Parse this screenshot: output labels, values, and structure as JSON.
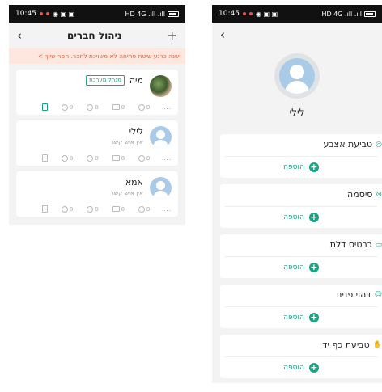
{
  "status": {
    "time": "10:45",
    "indicators": "HD 4G .ıll .ıll"
  },
  "left": {
    "title": "ניהול חברים",
    "back_icon": "chevron-left-icon",
    "add_icon": "plus-icon",
    "banner": "ישנה כרגע שיטת פתיחה לא משויכת לחבר. הסר שיוך >",
    "members": [
      {
        "name": "מיה",
        "badge": "מנהל מערכת",
        "subtitle": "",
        "counts": [
          "0",
          "0",
          "0",
          "0"
        ],
        "more": "..."
      },
      {
        "name": "לילי",
        "badge": "",
        "subtitle": "אין איש קשר",
        "counts": [
          "0",
          "0",
          "0",
          "0"
        ],
        "more": "..."
      },
      {
        "name": "אמא",
        "badge": "",
        "subtitle": "אין איש קשר",
        "counts": [
          "0",
          "0",
          "0",
          "0"
        ],
        "more": "..."
      }
    ]
  },
  "right": {
    "back_icon": "chevron-left-icon",
    "name": "לילי",
    "sections": [
      {
        "title": "טביעת אצבע",
        "icon": "fingerprint-icon",
        "add": "הוספה"
      },
      {
        "title": "סיסמה",
        "icon": "password-icon",
        "add": "הוספה"
      },
      {
        "title": "כרטיס דלת",
        "icon": "card-icon",
        "add": "הוספה"
      },
      {
        "title": "זיהוי פנים",
        "icon": "face-icon",
        "add": "הוספה"
      },
      {
        "title": "טביעת כף יד",
        "icon": "palm-icon",
        "add": "הוספה"
      }
    ]
  },
  "colors": {
    "accent": "#1aa384",
    "banner_bg": "#fde7df",
    "banner_text": "#d86545",
    "avatar": "#a9cbe8"
  }
}
